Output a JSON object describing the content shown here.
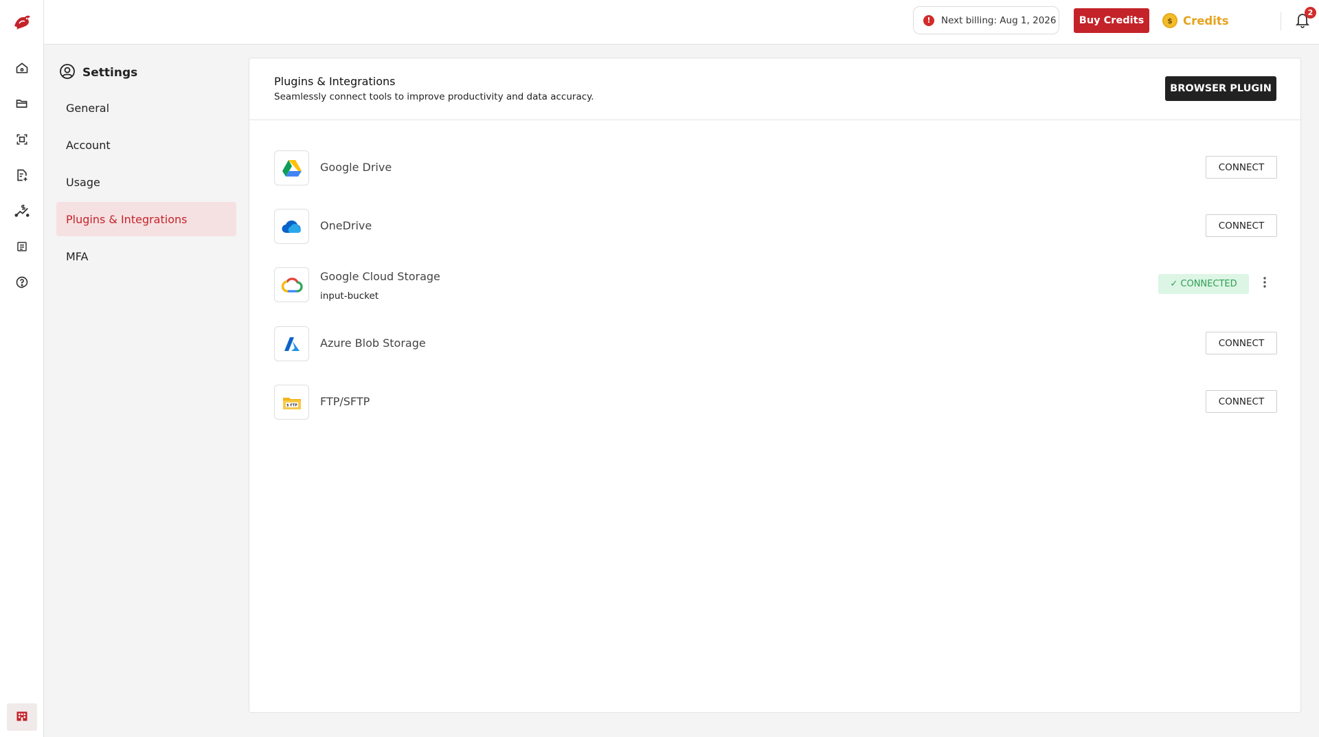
{
  "header": {
    "billing_text": "Next billing: Aug 1, 2026",
    "buy_credits_label": "Buy Credits",
    "credits_label": "Credits",
    "notification_count": "2"
  },
  "rail": {
    "icons": [
      "home-icon",
      "folder-icon",
      "scan-icon",
      "document-add-icon",
      "pricing-chart-icon",
      "list-icon",
      "help-icon"
    ],
    "bottom_icon": "building-icon"
  },
  "settings": {
    "title": "Settings",
    "items": [
      {
        "label": "General"
      },
      {
        "label": "Account"
      },
      {
        "label": "Usage"
      },
      {
        "label": "Plugins & Integrations",
        "active": true
      },
      {
        "label": "MFA"
      }
    ]
  },
  "main": {
    "title": "Plugins & Integrations",
    "subtitle": "Seamlessly connect tools to improve productivity and data accuracy.",
    "browser_plugin_label": "BROWSER PLUGIN",
    "connect_label": "CONNECT",
    "connected_label": "✓ CONNECTED",
    "integrations": [
      {
        "name": "Google Drive",
        "status": "disconnected"
      },
      {
        "name": "OneDrive",
        "status": "disconnected"
      },
      {
        "name": "Google Cloud Storage",
        "detail": "input-bucket",
        "status": "connected"
      },
      {
        "name": "Azure Blob Storage",
        "status": "disconnected"
      },
      {
        "name": "FTP/SFTP",
        "status": "disconnected"
      }
    ]
  },
  "colors": {
    "accent": "#c4232a",
    "credits": "#e6a21e",
    "connected_bg": "#dcf5e4",
    "connected_text": "#2e9e55"
  }
}
